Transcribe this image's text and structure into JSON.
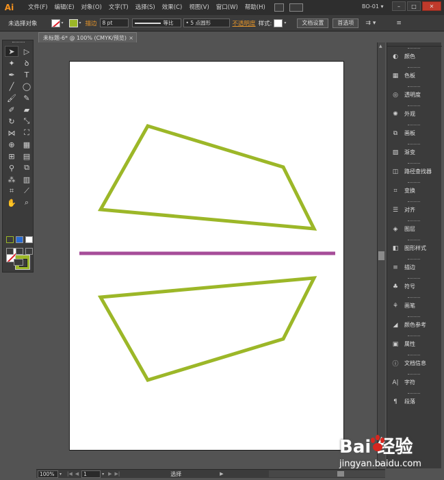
{
  "app": {
    "logo": "Ai",
    "workspace": "BO-01 ▾"
  },
  "menu": [
    "文件(F)",
    "编辑(E)",
    "对象(O)",
    "文字(T)",
    "选择(S)",
    "效果(C)",
    "视图(V)",
    "窗口(W)",
    "帮助(H)"
  ],
  "window_buttons": [
    "–",
    "□",
    "✕"
  ],
  "control": {
    "selection": "未选择对象",
    "stroke_label": "描边",
    "stroke_weight": "8 pt",
    "profile": "等比",
    "brush": "• 5 点圆形",
    "opacity_label": "不透明度",
    "style_label": "样式:",
    "doc_setup": "文档设置",
    "preferences": "首选项"
  },
  "document": {
    "tab_title": "未标题-6* @ 100% (CMYK/预览)",
    "close": "×"
  },
  "status": {
    "zoom": "100%",
    "artboard": "1",
    "state": "选择"
  },
  "panels": [
    {
      "icon": "color-icon",
      "label": "颜色"
    },
    {
      "icon": "swatches-icon",
      "label": "色板"
    },
    {
      "icon": "transparency-icon",
      "label": "透明度"
    },
    {
      "icon": "appearance-icon",
      "label": "外观"
    },
    {
      "icon": "artboards-icon",
      "label": "画板"
    },
    {
      "icon": "gradient-icon",
      "label": "渐变"
    },
    {
      "icon": "pathfinder-icon",
      "label": "路径查找器"
    },
    {
      "icon": "transform-icon",
      "label": "变换"
    },
    {
      "icon": "align-icon",
      "label": "对齐"
    },
    {
      "icon": "layers-icon",
      "label": "图层"
    },
    {
      "icon": "graphic-styles-icon",
      "label": "图形样式"
    },
    {
      "icon": "stroke-icon",
      "label": "描边"
    },
    {
      "icon": "symbols-icon",
      "label": "符号"
    },
    {
      "icon": "brushes-icon",
      "label": "画笔"
    },
    {
      "icon": "color-guide-icon",
      "label": "颜色参考"
    },
    {
      "icon": "attributes-icon",
      "label": "属性"
    },
    {
      "icon": "document-info-icon",
      "label": "文档信息"
    },
    {
      "icon": "character-icon",
      "label": "字符"
    },
    {
      "icon": "paragraph-icon",
      "label": "段落"
    }
  ],
  "colors": {
    "shape_stroke": "#9cb728",
    "divider_line": "#a64d99",
    "artboard": "#ffffff"
  },
  "watermark": {
    "brand": "Bai 经验",
    "url": "jingyan.baidu.com"
  }
}
